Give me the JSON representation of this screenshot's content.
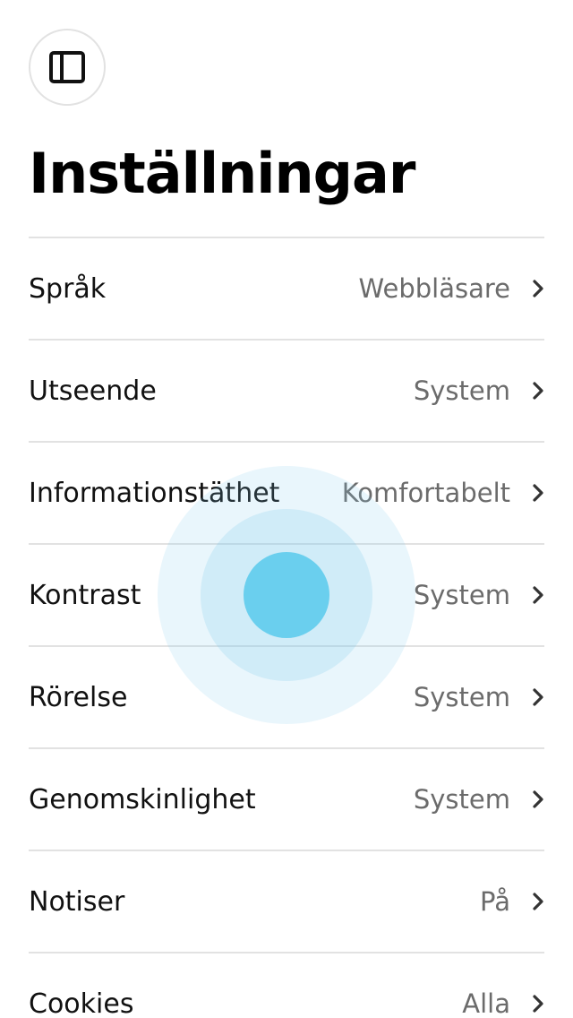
{
  "header": {
    "toggle_icon": "sidebar-panel-icon",
    "title": "Inställningar"
  },
  "settings": {
    "items": [
      {
        "label": "Språk",
        "value": "Webbläsare"
      },
      {
        "label": "Utseende",
        "value": "System"
      },
      {
        "label": "Informationstäthet",
        "value": "Komfortabelt"
      },
      {
        "label": "Kontrast",
        "value": "System"
      },
      {
        "label": "Rörelse",
        "value": "System"
      },
      {
        "label": "Genomskinlighet",
        "value": "System"
      },
      {
        "label": "Notiser",
        "value": "På"
      },
      {
        "label": "Cookies",
        "value": "Alla"
      }
    ]
  },
  "colors": {
    "touch_indicator": "#6acfee",
    "divider": "#e2e2e2",
    "value_text": "#6b6b6b"
  }
}
